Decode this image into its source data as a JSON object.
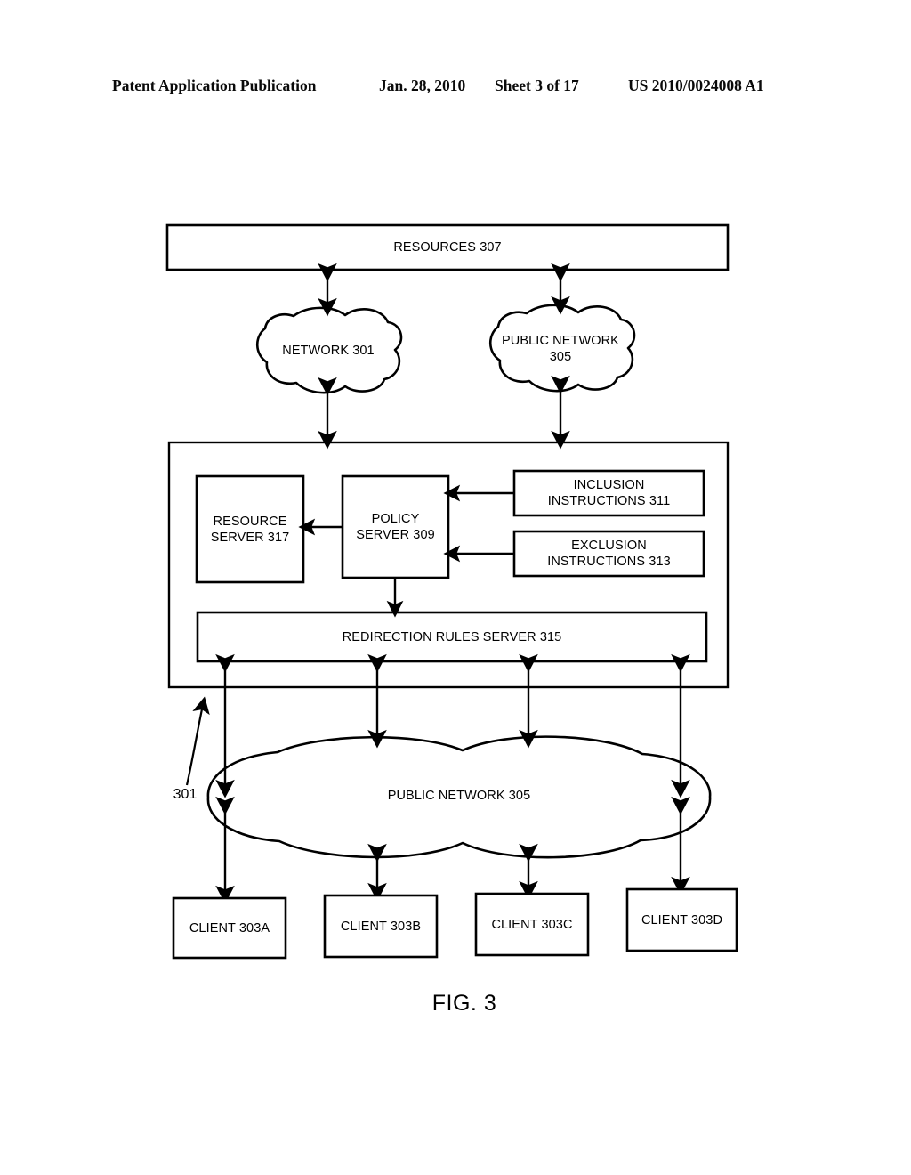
{
  "header": {
    "title": "Patent Application Publication",
    "date": "Jan. 28, 2010",
    "sheet": "Sheet 3 of 17",
    "number": "US 2010/0024008 A1"
  },
  "figure": {
    "caption": "FIG. 3",
    "reference_numeral": "301"
  },
  "nodes": {
    "resources": "RESOURCES 307",
    "network_301": "NETWORK 301",
    "public_network_top": "PUBLIC NETWORK\n305",
    "resource_server": "RESOURCE\nSERVER 317",
    "policy_server": "POLICY\nSERVER 309",
    "inclusion_instructions": "INCLUSION\nINSTRUCTIONS 311",
    "exclusion_instructions": "EXCLUSION\nINSTRUCTIONS 313",
    "redirection_rules_server": "REDIRECTION RULES SERVER 315",
    "public_network_bottom": "PUBLIC NETWORK 305",
    "client_a": "CLIENT 303A",
    "client_b": "CLIENT 303B",
    "client_c": "CLIENT 303C",
    "client_d": "CLIENT 303D"
  },
  "colors": {
    "ink": "#000000",
    "paper": "#ffffff"
  }
}
